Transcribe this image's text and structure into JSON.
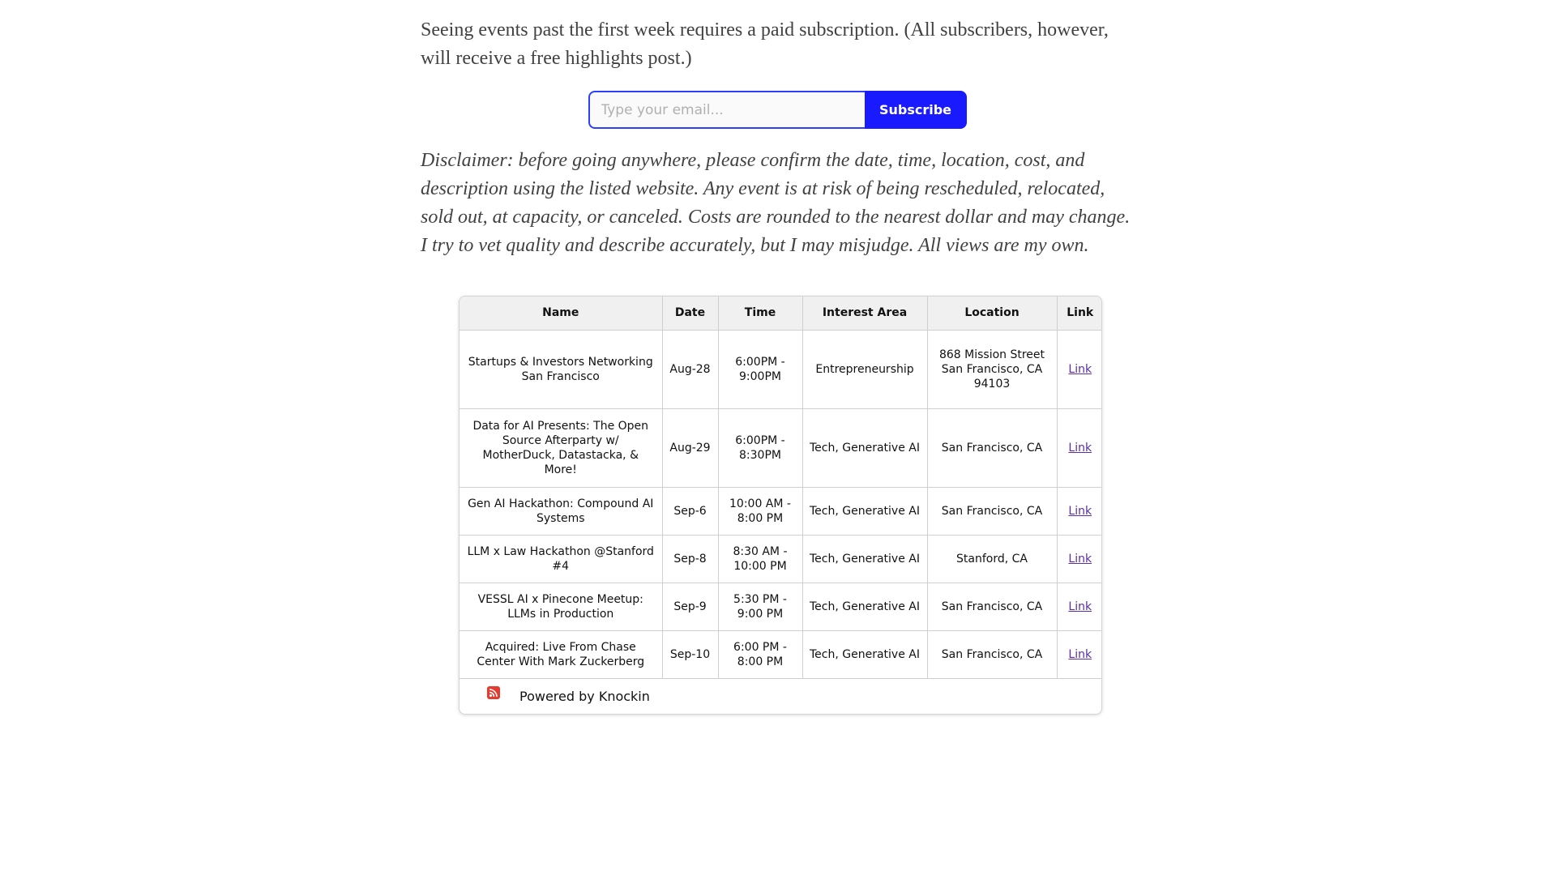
{
  "intro": {
    "text": "Seeing events past the first week requires a paid subscription. (All subscribers, however, will receive a free highlights post.)"
  },
  "subscribe": {
    "placeholder": "Type your email...",
    "button_label": "Subscribe"
  },
  "disclaimer": {
    "text": "Disclaimer: before going anywhere, please confirm the date, time, location, cost, and description using the listed website. Any event is at risk of being rescheduled, relocated, sold out, at capacity, or canceled. Costs are rounded to the nearest dollar and may change. I try to vet quality and describe accurately, but I may misjudge. All views are my own."
  },
  "table": {
    "headers": [
      "Name",
      "Date",
      "Time",
      "Interest Area",
      "Location",
      "Link"
    ],
    "rows": [
      [
        "Startups & Investors Networking San Francisco",
        "Aug-28",
        "6:00PM - 9:00PM",
        "Entrepreneurship",
        "868 Mission Street San Francisco, CA 94103",
        "Link"
      ],
      [
        "Data for AI Presents: The Open Source Afterparty w/ MotherDuck, Datastacka, & More!",
        "Aug-29",
        "6:00PM - 8:30PM",
        "Tech, Generative AI",
        "San Francisco, CA",
        "Link"
      ],
      [
        "Gen AI Hackathon: Compound AI Systems",
        "Sep-6",
        "10:00 AM - 8:00 PM",
        "Tech, Generative AI",
        "San Francisco, CA",
        "Link"
      ],
      [
        "LLM x Law Hackathon @Stanford #4",
        "Sep-8",
        "8:30 AM - 10:00 PM",
        "Tech, Generative AI",
        "Stanford, CA",
        "Link"
      ],
      [
        "VESSL AI x Pinecone Meetup: LLMs in Production",
        "Sep-9",
        "5:30 PM - 9:00 PM",
        "Tech, Generative AI",
        "San Francisco, CA",
        "Link"
      ],
      [
        "Acquired: Live From Chase Center With Mark Zuckerberg",
        "Sep-10",
        "6:00 PM - 8:00 PM",
        "Tech, Generative AI",
        "San Francisco, CA",
        "Link"
      ]
    ],
    "footer": {
      "icon": "rss-icon",
      "text": "Powered by Knockin"
    }
  },
  "colors": {
    "accent": "#1a1afe",
    "link": "#5a2ea6",
    "icon": "#e53a2e"
  }
}
